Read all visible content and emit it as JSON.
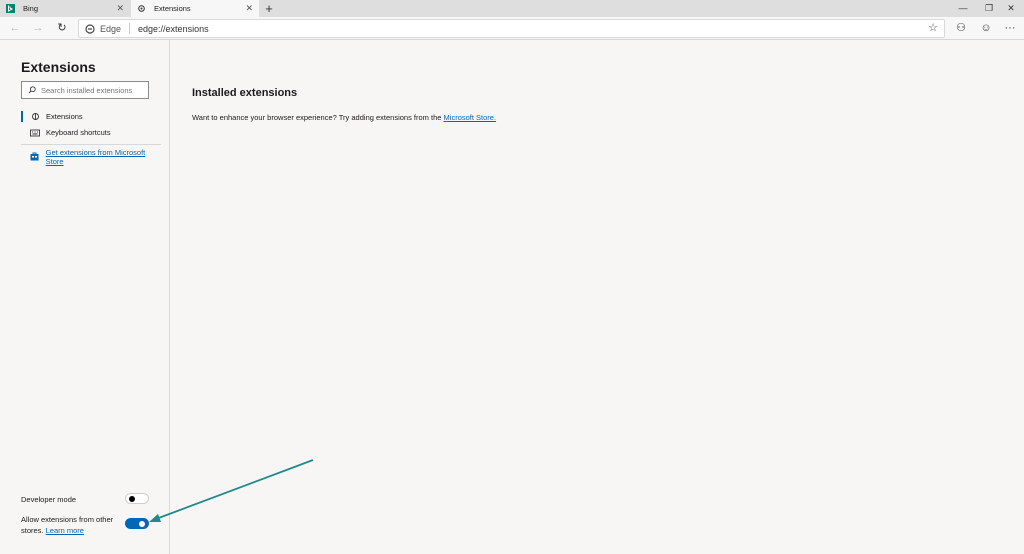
{
  "tabs": [
    {
      "title": "Bing",
      "active": false
    },
    {
      "title": "Extensions",
      "active": true
    }
  ],
  "tabbar": {
    "close_glyph": "✕",
    "new_tab_glyph": "+",
    "minimize_glyph": "—",
    "restore_glyph": "❐",
    "close_window_glyph": "✕"
  },
  "toolbar": {
    "back_glyph": "←",
    "forward_glyph": "→",
    "refresh_glyph": "↻",
    "site_label": "Edge",
    "url": "edge://extensions",
    "favorite_glyph": "☆",
    "profile_glyph": "⚇",
    "emoji_glyph": "☺",
    "menu_glyph": "···"
  },
  "sidebar": {
    "title": "Extensions",
    "search_placeholder": "Search installed extensions",
    "nav": [
      {
        "label": "Extensions",
        "icon": "puzzle-icon",
        "selected": true
      },
      {
        "label": "Keyboard shortcuts",
        "icon": "keyboard-icon",
        "selected": false
      }
    ],
    "store_link": "Get extensions from Microsoft Store",
    "developer_mode": {
      "label": "Developer mode",
      "enabled": false
    },
    "allow_other_stores": {
      "label": "Allow extensions from other stores.",
      "learn_more": "Learn more",
      "enabled": true
    }
  },
  "main": {
    "title": "Installed extensions",
    "text_before": "Want to enhance your browser experience? Try adding extensions from the ",
    "store_link": "Microsoft Store."
  },
  "colors": {
    "accent": "#0067b8",
    "annotation_arrow": "#1f8a8a",
    "bing_icon": "#008373"
  }
}
